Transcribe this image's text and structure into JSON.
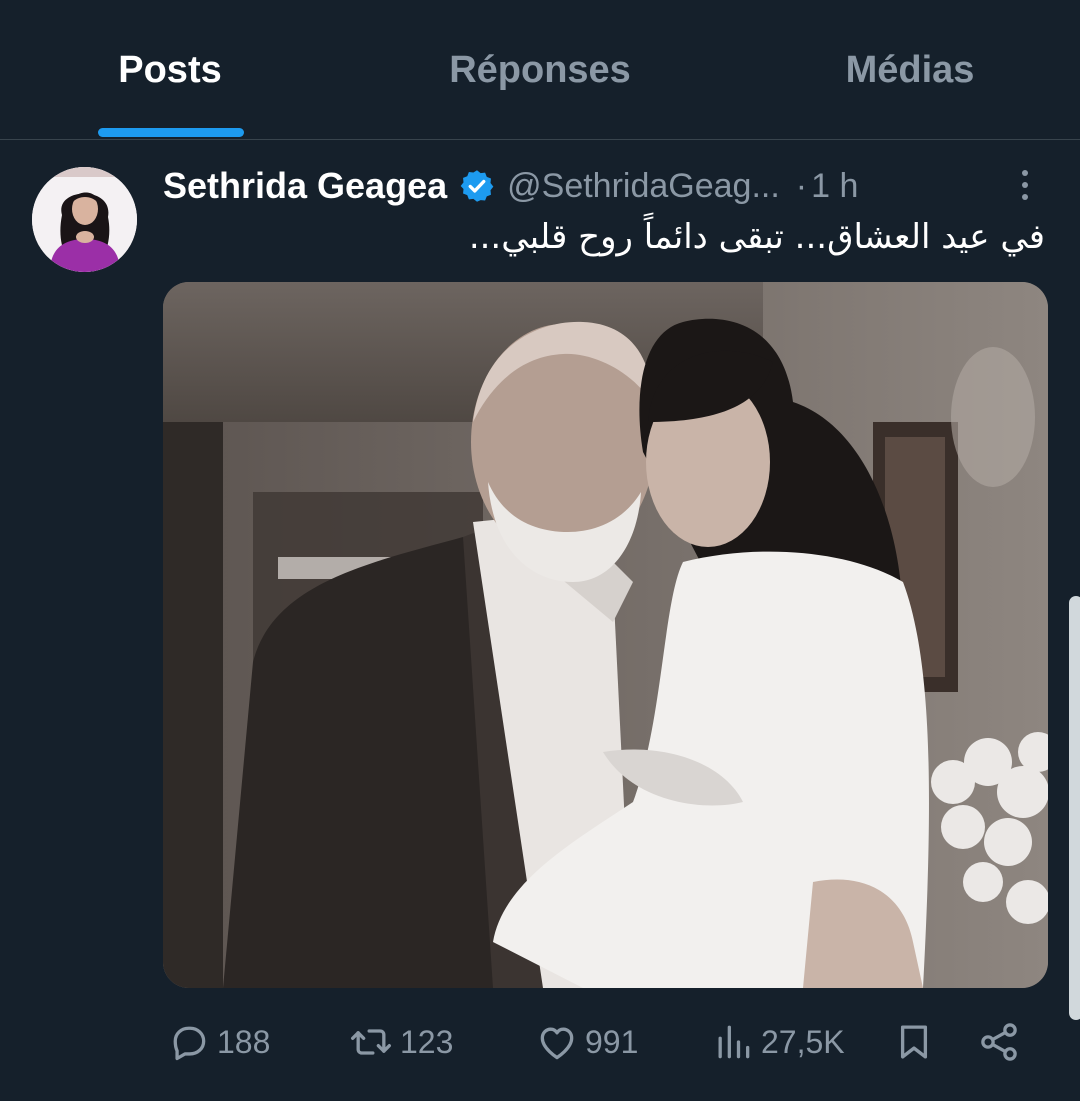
{
  "tabs": [
    {
      "label": "Posts",
      "active": true
    },
    {
      "label": "Réponses",
      "active": false
    },
    {
      "label": "Médias",
      "active": false
    }
  ],
  "colors": {
    "background": "#15202b",
    "accent": "#1d9bf0",
    "secondary_text": "#8b98a5",
    "divider": "#38444d"
  },
  "tweet": {
    "author_name": "Sethrida Geagea",
    "verified_icon": "verified-badge-icon",
    "handle": "@SethridaGeag...",
    "separator": "·",
    "timestamp": "1 h",
    "text": "في عيد العشاق... تبقى دائماً روح قلبي...",
    "media_description_icon": "photo",
    "actions": {
      "reply_count": "188",
      "retweet_count": "123",
      "like_count": "991",
      "view_count": "27,5K"
    }
  }
}
